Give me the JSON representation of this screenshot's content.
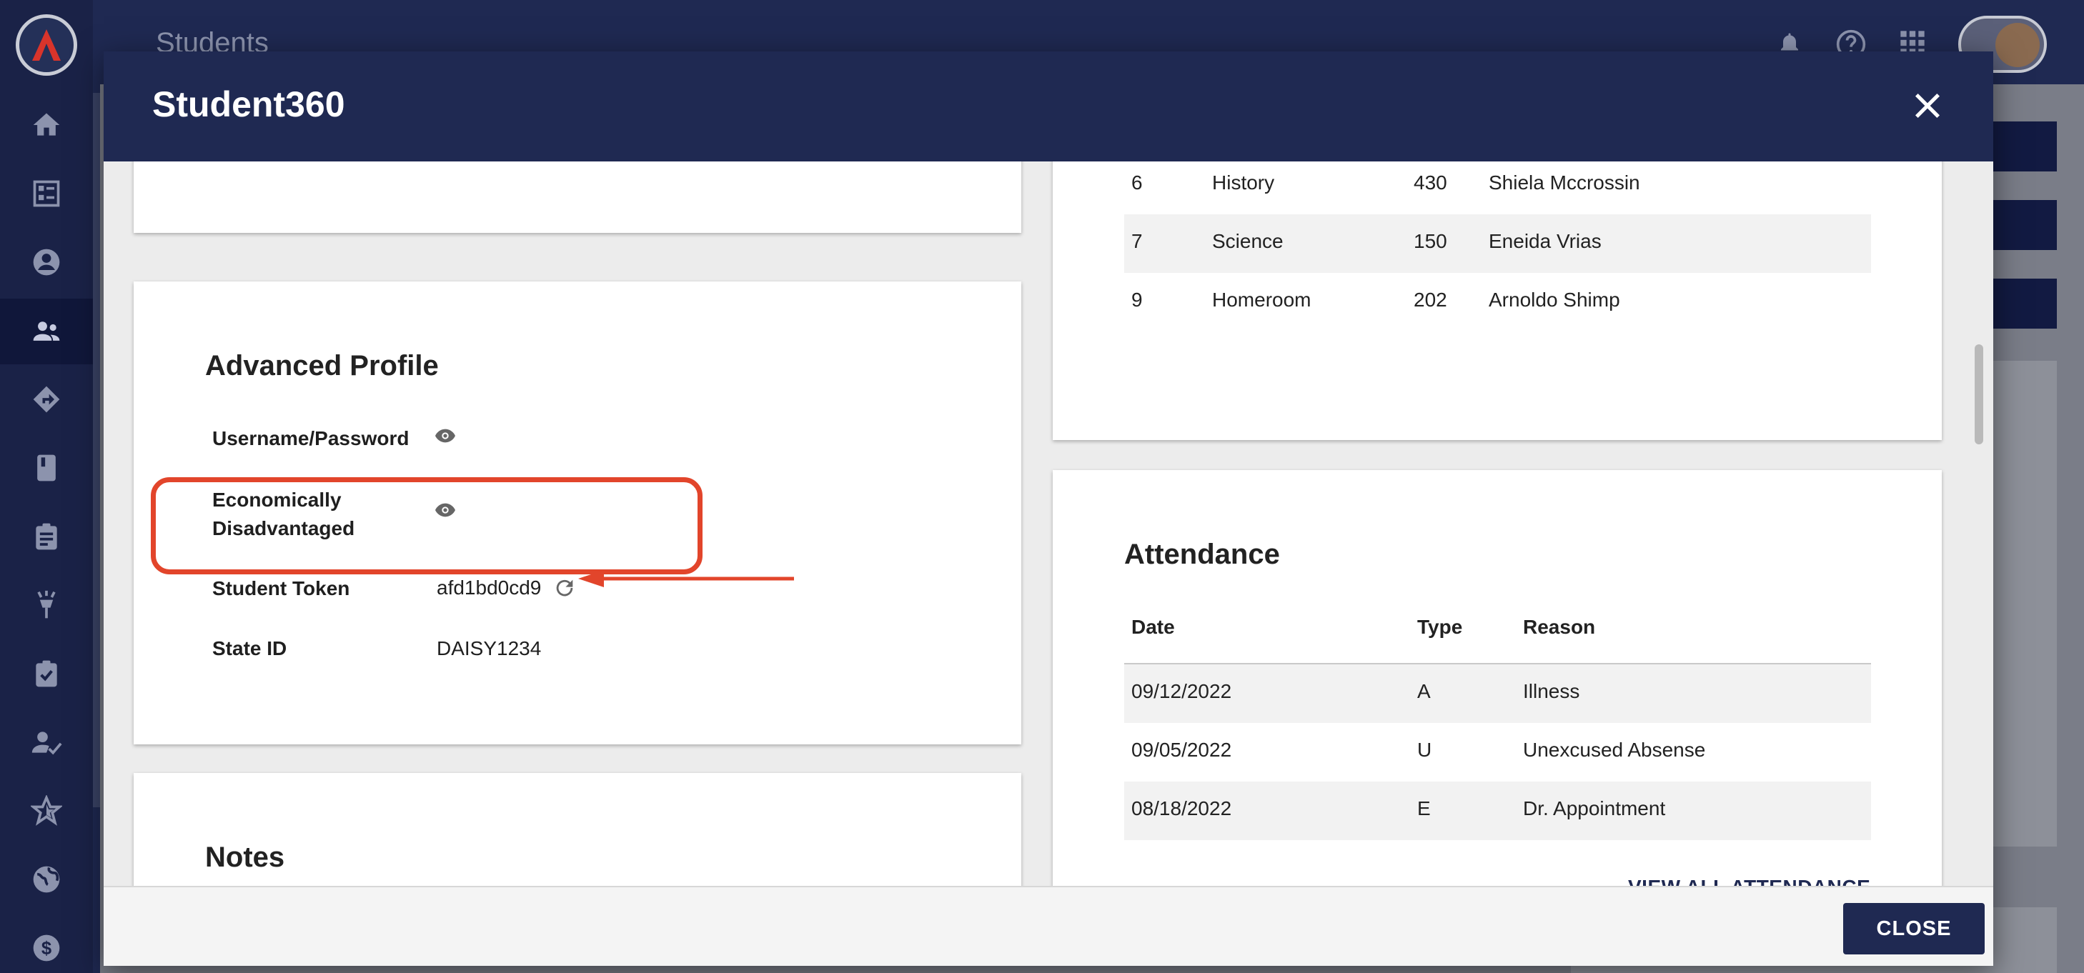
{
  "app": {
    "background_title": "Students"
  },
  "sidebar": {
    "items": [
      {
        "icon": "home-icon"
      },
      {
        "icon": "dashboard-icon"
      },
      {
        "icon": "account-circle-icon"
      },
      {
        "icon": "people-icon",
        "active": true
      },
      {
        "icon": "directions-icon"
      },
      {
        "icon": "book-icon"
      },
      {
        "icon": "clipboard-icon"
      },
      {
        "icon": "lamp-icon"
      },
      {
        "icon": "assignment-check-icon"
      },
      {
        "icon": "person-check-icon"
      },
      {
        "icon": "star-icon"
      },
      {
        "icon": "globe-icon"
      },
      {
        "icon": "dollar-icon"
      }
    ]
  },
  "modal": {
    "title": "Student360",
    "close_label": "CLOSE",
    "advanced_profile": {
      "title": "Advanced Profile",
      "username_label": "Username/Password",
      "economically_label_line1": "Economically",
      "economically_label_line2": "Disadvantaged",
      "student_token_label": "Student Token",
      "student_token_value": "afd1bd0cd9",
      "state_id_label": "State ID",
      "state_id_value": "DAISY1234"
    },
    "notes": {
      "title": "Notes"
    },
    "schedule": {
      "rows": [
        {
          "period": "6",
          "course": "History",
          "room": "430",
          "teacher": "Shiela Mccrossin"
        },
        {
          "period": "7",
          "course": "Science",
          "room": "150",
          "teacher": "Eneida Vrias"
        },
        {
          "period": "9",
          "course": "Homeroom",
          "room": "202",
          "teacher": "Arnoldo Shimp"
        }
      ]
    },
    "attendance": {
      "title": "Attendance",
      "headers": {
        "date": "Date",
        "type": "Type",
        "reason": "Reason"
      },
      "rows": [
        {
          "date": "09/12/2022",
          "type": "A",
          "reason": "Illness"
        },
        {
          "date": "09/05/2022",
          "type": "U",
          "reason": "Unexcused Absense"
        },
        {
          "date": "08/18/2022",
          "type": "E",
          "reason": "Dr. Appointment"
        }
      ],
      "view_all_label": "VIEW ALL ATTENDANCE"
    }
  },
  "colors": {
    "navy": "#1f2952",
    "highlight": "#e2452b",
    "accent_text": "#1f2952"
  }
}
